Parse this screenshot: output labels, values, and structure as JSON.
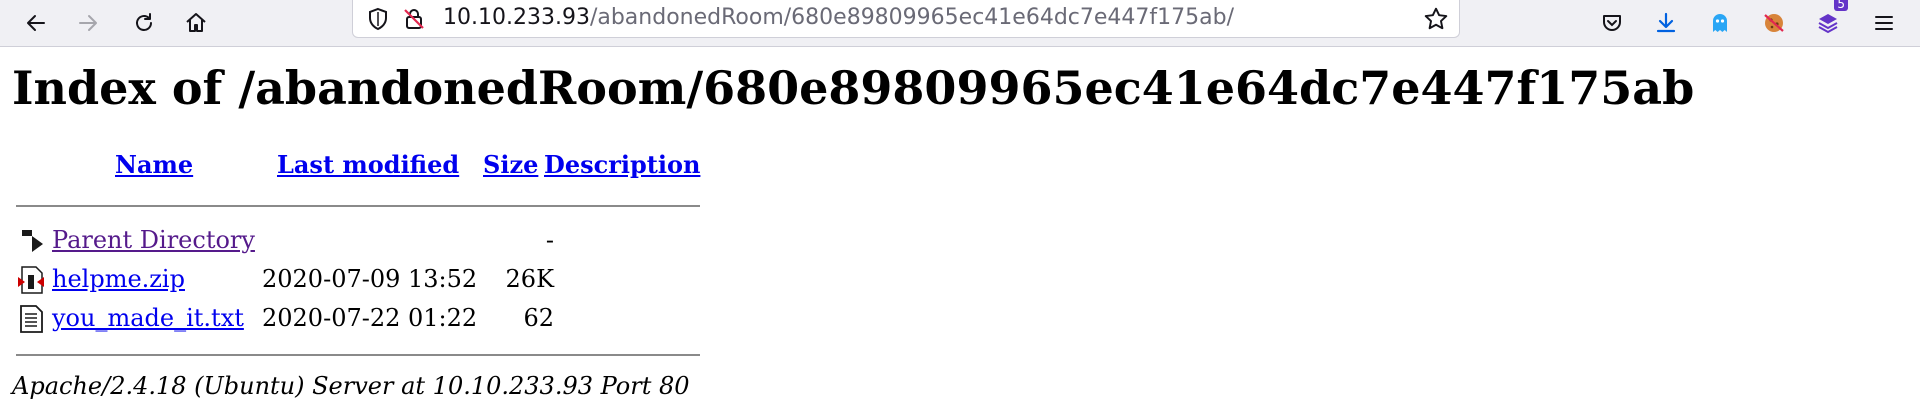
{
  "browser": {
    "url_host": "10.10.233.93",
    "url_path": "/abandonedRoom/680e89809965ec41e64dc7e447f175ab/",
    "extension_badge": "5",
    "icons": {
      "back": "arrow-left-icon",
      "forward": "arrow-right-icon",
      "reload": "reload-icon",
      "home": "home-icon",
      "tracking": "shield-icon",
      "insecure": "insecure-lock-icon",
      "bookmark": "star-icon",
      "pocket": "pocket-icon",
      "downloads": "download-icon",
      "ext1": "ghost-extension-icon",
      "ext2": "cookie-extension-icon",
      "ext3": "extension-stack-icon",
      "menu": "hamburger-menu-icon"
    },
    "colors": {
      "toolbar": "#f0f0f4",
      "download_blue": "#0061e0",
      "ghost_blue": "#2aa6f5",
      "badge_purple": "#6434c8"
    }
  },
  "page": {
    "title": "Index of /abandonedRoom/680e89809965ec41e64dc7e447f175ab",
    "columns": {
      "name": "Name",
      "last_modified": "Last modified",
      "size": "Size",
      "description": "Description"
    },
    "entries": [
      {
        "name": "Parent Directory",
        "modified": "",
        "size": "-",
        "icon": "parent-directory-icon",
        "visited": true
      },
      {
        "name": "helpme.zip",
        "modified": "2020-07-09 13:52",
        "size": "26K",
        "icon": "compressed-file-icon",
        "visited": false
      },
      {
        "name": "you_made_it.txt",
        "modified": "2020-07-22 01:22",
        "size": "62",
        "icon": "text-file-icon",
        "visited": false
      }
    ],
    "footer": "Apache/2.4.18 (Ubuntu) Server at 10.10.233.93 Port 80",
    "colors": {
      "link": "#0000ee",
      "visited": "#551a8b"
    }
  }
}
